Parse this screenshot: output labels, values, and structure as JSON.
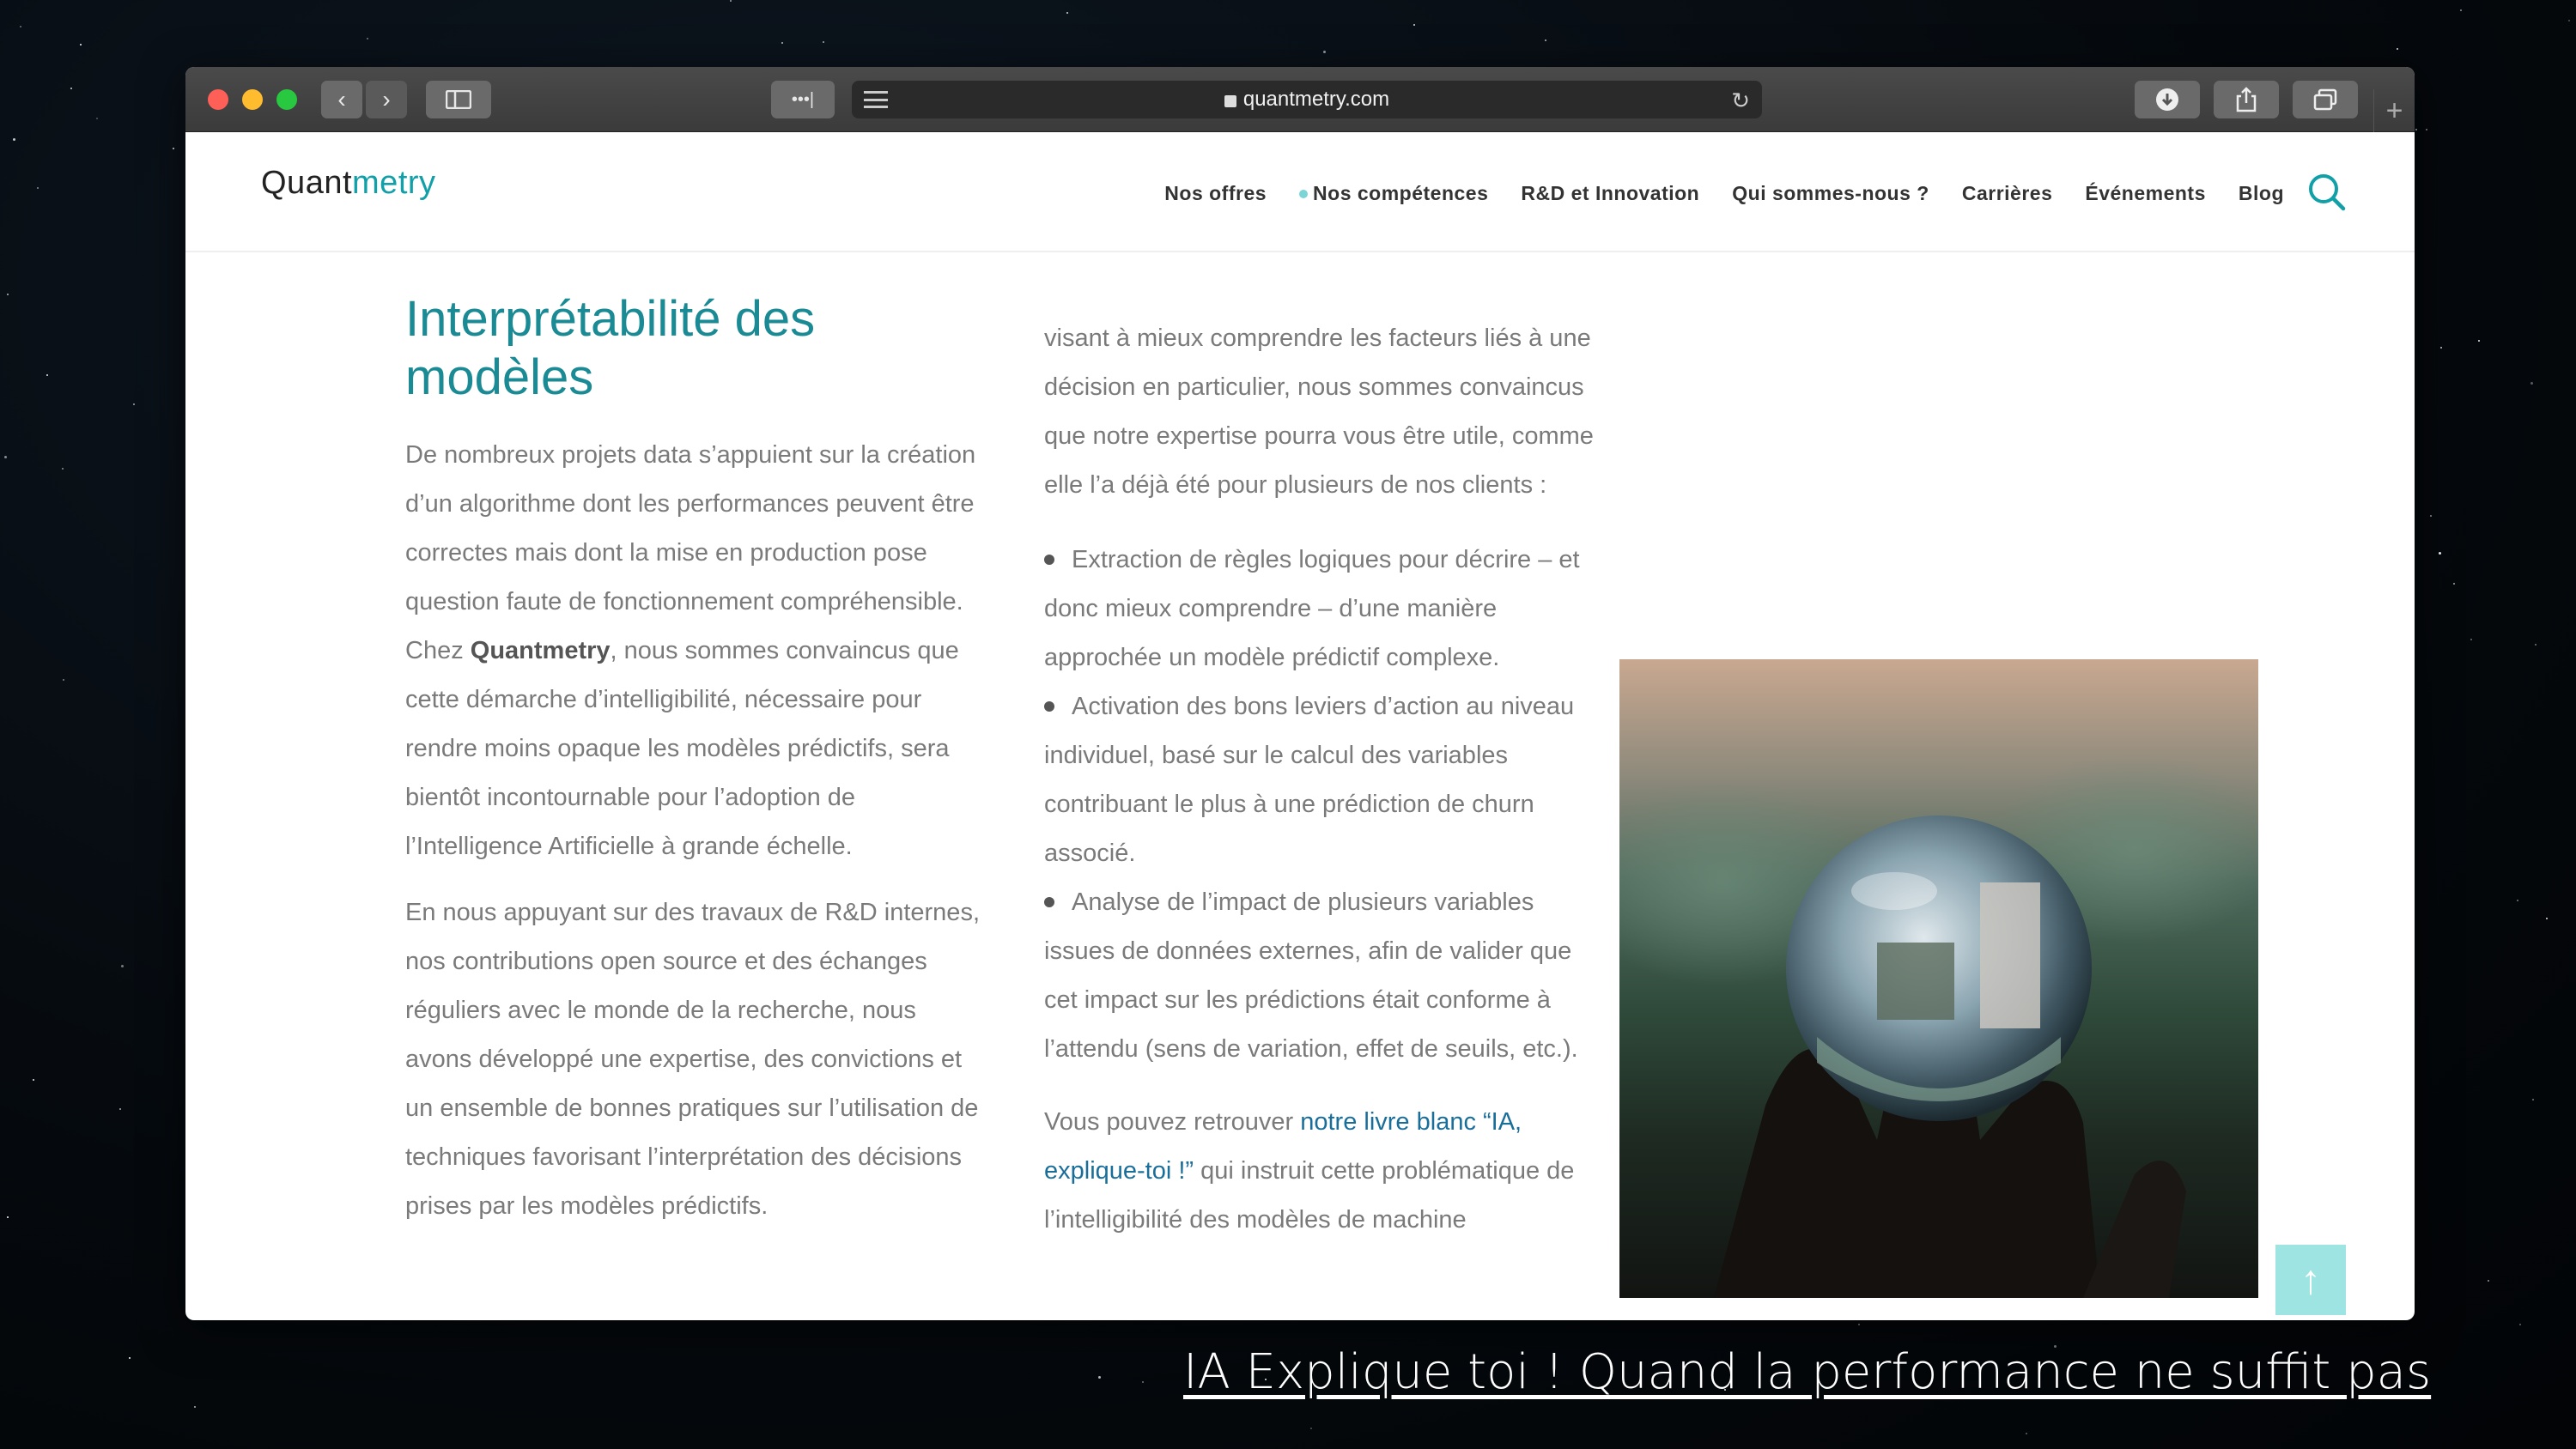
{
  "browser": {
    "url": "quantmetry.com",
    "new_tab": "+"
  },
  "site": {
    "logo_part1": "Quant",
    "logo_part2": "metry",
    "nav": [
      "Nos offres",
      "Nos compétences",
      "R&D et Innovation",
      "Qui sommes-nous ?",
      "Carrières",
      "Événements",
      "Blog"
    ]
  },
  "article": {
    "title": "Interprétabilité des modèles",
    "col1_p1_a": "De nombreux projets data s’appuient sur la création d’un algorithme dont les performances peuvent être correctes mais dont la mise en production pose question faute de fonctionnement compréhensible. Chez ",
    "col1_p1_b": "Quantmetry",
    "col1_p1_c": ", nous sommes convaincus que cette démarche d’intelligibilité, nécessaire pour rendre moins opaque les modèles prédictifs, sera bientôt incontournable pour l’adoption de l’Intelligence Artificielle à grande échelle.",
    "col1_p2": "En nous appuyant sur des travaux de R&D internes, nos contributions open source et des échanges réguliers avec le monde de la recherche, nous avons développé une expertise, des convictions et un ensemble de bonnes pratiques sur l’utilisation de techniques favorisant l’interprétation des décisions prises par les modèles prédictifs.",
    "col2_p1": "visant à mieux comprendre les facteurs liés à une décision en particulier, nous sommes convaincus que notre expertise pourra vous être utile, comme elle l’a déjà été pour plusieurs de nos clients :",
    "bullets": [
      "Extraction de règles logiques pour décrire – et donc mieux comprendre – d’une manière approchée un modèle prédictif complexe.",
      "Activation des bons leviers d’action au niveau individuel, basé sur le calcul des variables contribuant le plus à une prédiction de churn associé.",
      "Analyse de l’impact de plusieurs variables issues de données externes, afin de valider que cet impact sur les prédictions était conforme à l’attendu (sens de variation, effet de seuils, etc.)."
    ],
    "col2_p2_a": "Vous pouvez retrouver ",
    "col2_p2_link": "notre livre blanc “IA, explique-toi !”",
    "col2_p2_b": " qui instruit cette problématique de l’intelligibilité des modèles de machine"
  },
  "caption": "IA Explique toi ! Quand la performance ne suffit pas",
  "colors": {
    "accent": "#1a8a94",
    "link": "#1a6e9a",
    "backtop": "#9ee4e2"
  },
  "icons": [
    "back-icon",
    "forward-icon",
    "sidebar-icon",
    "reader-icon",
    "lock-icon",
    "reload-icon",
    "download-icon",
    "share-icon",
    "tabs-icon",
    "search-icon",
    "arrow-up-icon"
  ]
}
